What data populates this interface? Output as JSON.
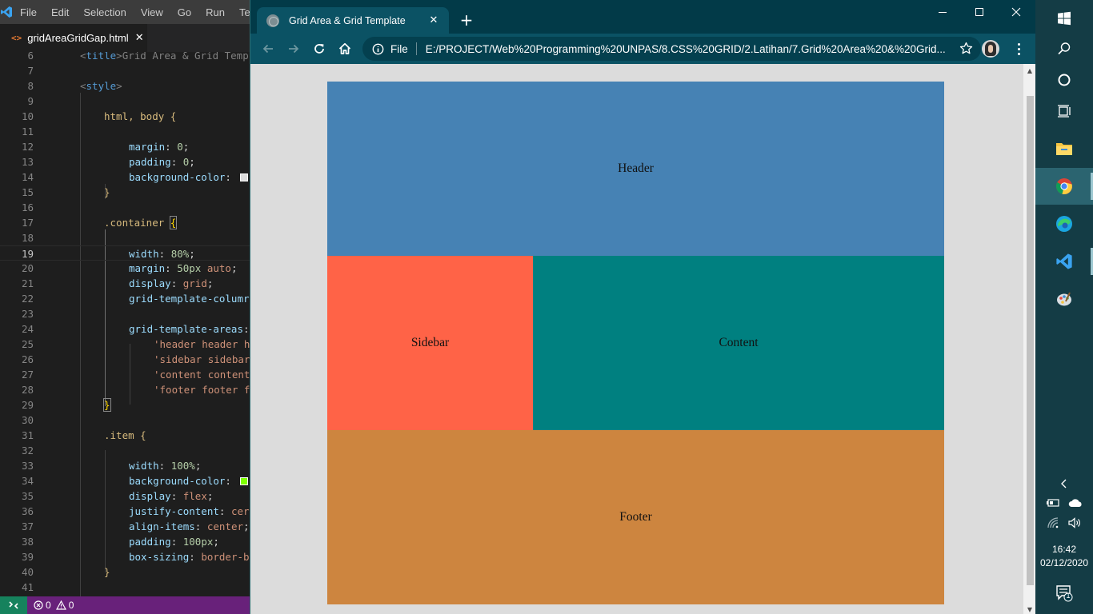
{
  "vscode": {
    "menu": [
      "File",
      "Edit",
      "Selection",
      "View",
      "Go",
      "Run",
      "Te"
    ],
    "tab": {
      "icon": "<>",
      "label": "gridAreaGridGap.html",
      "close": "✕"
    },
    "lines": {
      "l6": {
        "num": "6",
        "parts": [
          "<",
          "title",
          ">Grid Area & Grid Temp"
        ]
      },
      "l7": {
        "num": "7"
      },
      "l8": {
        "num": "8",
        "parts": [
          "<",
          "style",
          ">"
        ]
      },
      "l9": {
        "num": "9"
      },
      "l10": {
        "num": "10",
        "parts": [
          "html, body ",
          "{"
        ]
      },
      "l11": {
        "num": "11"
      },
      "l12": {
        "num": "12",
        "parts": [
          "margin",
          ": ",
          "0",
          ";"
        ]
      },
      "l13": {
        "num": "13",
        "parts": [
          "padding",
          ": ",
          "0",
          ";"
        ]
      },
      "l14": {
        "num": "14",
        "parts": [
          "background-color",
          ": "
        ]
      },
      "l15": {
        "num": "15",
        "parts": [
          "}"
        ]
      },
      "l16": {
        "num": "16"
      },
      "l17": {
        "num": "17",
        "parts": [
          ".container ",
          "{"
        ]
      },
      "l18": {
        "num": "18"
      },
      "l19": {
        "num": "19",
        "parts": [
          "width",
          ": ",
          "80%",
          ";"
        ]
      },
      "l20": {
        "num": "20",
        "parts": [
          "margin",
          ": ",
          "50px",
          " ",
          "auto",
          ";"
        ]
      },
      "l21": {
        "num": "21",
        "parts": [
          "display",
          ": ",
          "grid",
          ";"
        ]
      },
      "l22": {
        "num": "22",
        "parts": [
          "grid-template-columr"
        ]
      },
      "l23": {
        "num": "23"
      },
      "l24": {
        "num": "24",
        "parts": [
          "grid-template-areas",
          ":"
        ]
      },
      "l25": {
        "num": "25",
        "parts": [
          "'header header h"
        ]
      },
      "l26": {
        "num": "26",
        "parts": [
          "'sidebar sidebar"
        ]
      },
      "l27": {
        "num": "27",
        "parts": [
          "'content content"
        ]
      },
      "l28": {
        "num": "28",
        "parts": [
          "'footer footer f"
        ]
      },
      "l29": {
        "num": "29",
        "parts": [
          "}"
        ]
      },
      "l30": {
        "num": "30"
      },
      "l31": {
        "num": "31",
        "parts": [
          ".item ",
          "{"
        ]
      },
      "l32": {
        "num": "32"
      },
      "l33": {
        "num": "33",
        "parts": [
          "width",
          ": ",
          "100%",
          ";"
        ]
      },
      "l34": {
        "num": "34",
        "parts": [
          "background-color",
          ": "
        ]
      },
      "l35": {
        "num": "35",
        "parts": [
          "display",
          ": ",
          "flex",
          ";"
        ]
      },
      "l36": {
        "num": "36",
        "parts": [
          "justify-content",
          ": ",
          "cer"
        ]
      },
      "l37": {
        "num": "37",
        "parts": [
          "align-items",
          ": ",
          "center",
          ";"
        ]
      },
      "l38": {
        "num": "38",
        "parts": [
          "padding",
          ": ",
          "100px",
          ";"
        ]
      },
      "l39": {
        "num": "39",
        "parts": [
          "box-sizing",
          ": ",
          "border-b"
        ]
      },
      "l40": {
        "num": "40",
        "parts": [
          "}"
        ]
      },
      "l41": {
        "num": "41"
      }
    },
    "swatch_colors": {
      "body_bg": "#dcdcdc",
      "item_bg": "#7fff00"
    },
    "status": {
      "errors": "0",
      "warnings": "0"
    }
  },
  "chrome": {
    "tab_title": "Grid Area & Grid Template",
    "tab_close": "✕",
    "new_tab": "+",
    "omnibox": {
      "scheme_label": "File",
      "url": "E:/PROJECT/Web%20Programming%20UNPAS/8.CSS%20GRID/2.Latihan/7.Grid%20Area%20&%20Grid..."
    },
    "page": {
      "items": {
        "header": {
          "label": "Header",
          "color": "#4682b4"
        },
        "sidebar": {
          "label": "Sidebar",
          "color": "#ff6347"
        },
        "content": {
          "label": "Content",
          "color": "#008080"
        },
        "footer": {
          "label": "Footer",
          "color": "#cd853f"
        }
      },
      "background": "#dcdcdc"
    }
  },
  "taskbar": {
    "time": "16:42",
    "date": "02/12/2020",
    "notification_count": "1",
    "apps": [
      "windows-logo-icon",
      "search-icon",
      "cortana-icon",
      "task-view-icon",
      "file-explorer-icon",
      "chrome-icon",
      "edge-icon",
      "vscode-icon",
      "paint-icon"
    ]
  }
}
